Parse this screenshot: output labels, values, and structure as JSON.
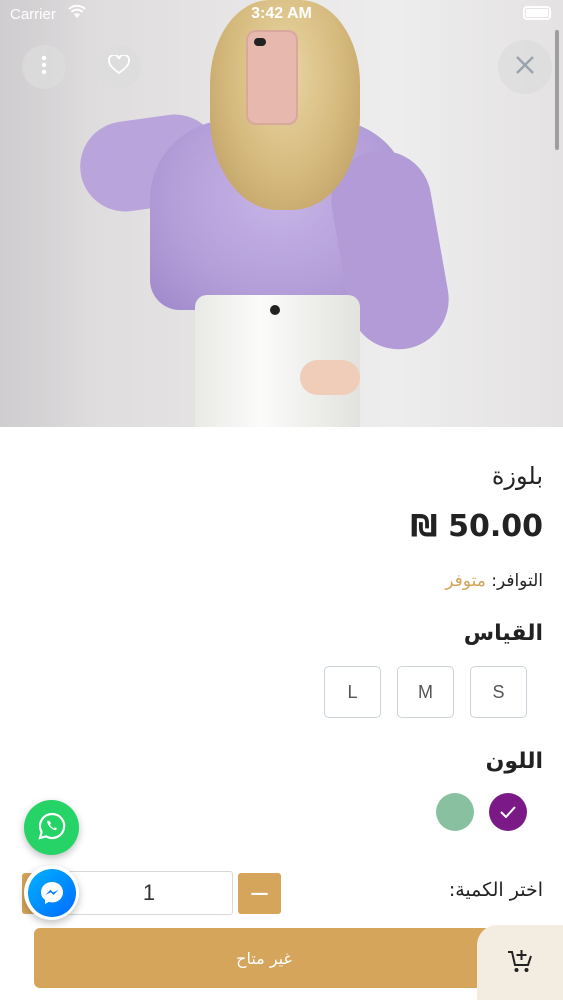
{
  "status_bar": {
    "carrier": "Carrier",
    "time": "3:42 AM"
  },
  "icons": {
    "more": "more-vertical-icon",
    "favorite": "heart-icon",
    "close": "close-icon",
    "whatsapp": "whatsapp-icon",
    "messenger": "messenger-icon",
    "cart": "add-to-cart-icon",
    "check": "check-icon"
  },
  "product": {
    "title": "بلوزة",
    "price": "₪ 50.00",
    "availability_label": "التوافر:",
    "availability_value": "متوفر"
  },
  "size": {
    "heading": "القياس",
    "options": [
      "S",
      "M",
      "L"
    ]
  },
  "color": {
    "heading": "اللون",
    "swatches": [
      {
        "hex": "#7b1a86",
        "selected": true
      },
      {
        "hex": "#88c0a0",
        "selected": false
      }
    ]
  },
  "quantity": {
    "label": "اختر الكمية:",
    "value": "1",
    "minus": "−"
  },
  "cart_button": {
    "label": "غير متاح"
  },
  "colors": {
    "accent": "#d4a55a",
    "availability": "#d4a35a"
  }
}
